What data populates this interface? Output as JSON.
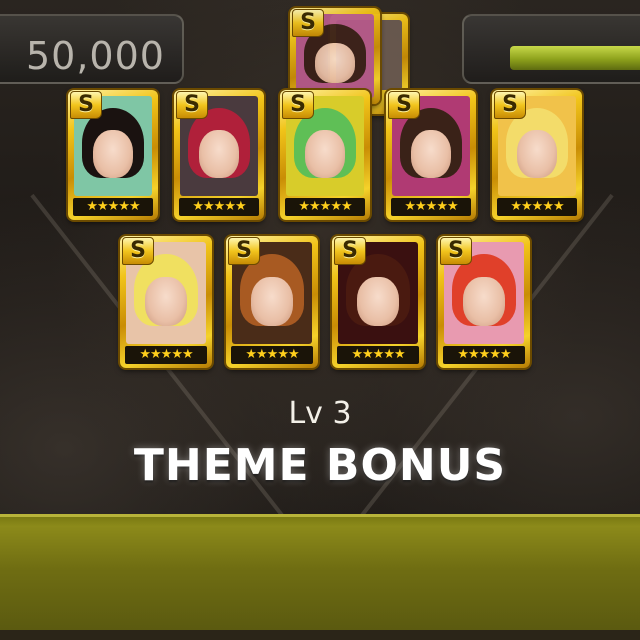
{
  "hud": {
    "score": "50,000",
    "gauge_level": 0.75
  },
  "theme": {
    "level_label": "Lv 3",
    "title": "THEME BONUS"
  },
  "cards": {
    "rank_letter": "S",
    "stars": "★★★★★",
    "colors": {
      "frame_gold": "#f1c419",
      "star_yellow": "#ffcf1c",
      "bar_olive": "#8c8a1a",
      "gauge_green": "#a4bb2a"
    },
    "row1": [
      {
        "bg": "#7fc6a5"
      },
      {
        "bg": "#4a3a3e"
      },
      {
        "bg": "#d8cc2a"
      },
      {
        "bg": "#b03a73"
      },
      {
        "bg": "#f1c24a"
      }
    ],
    "row2": [
      {
        "bg": "#e8c4a8"
      },
      {
        "bg": "#4a2c18"
      },
      {
        "bg": "#3a1010"
      },
      {
        "bg": "#e89ab0"
      }
    ]
  }
}
